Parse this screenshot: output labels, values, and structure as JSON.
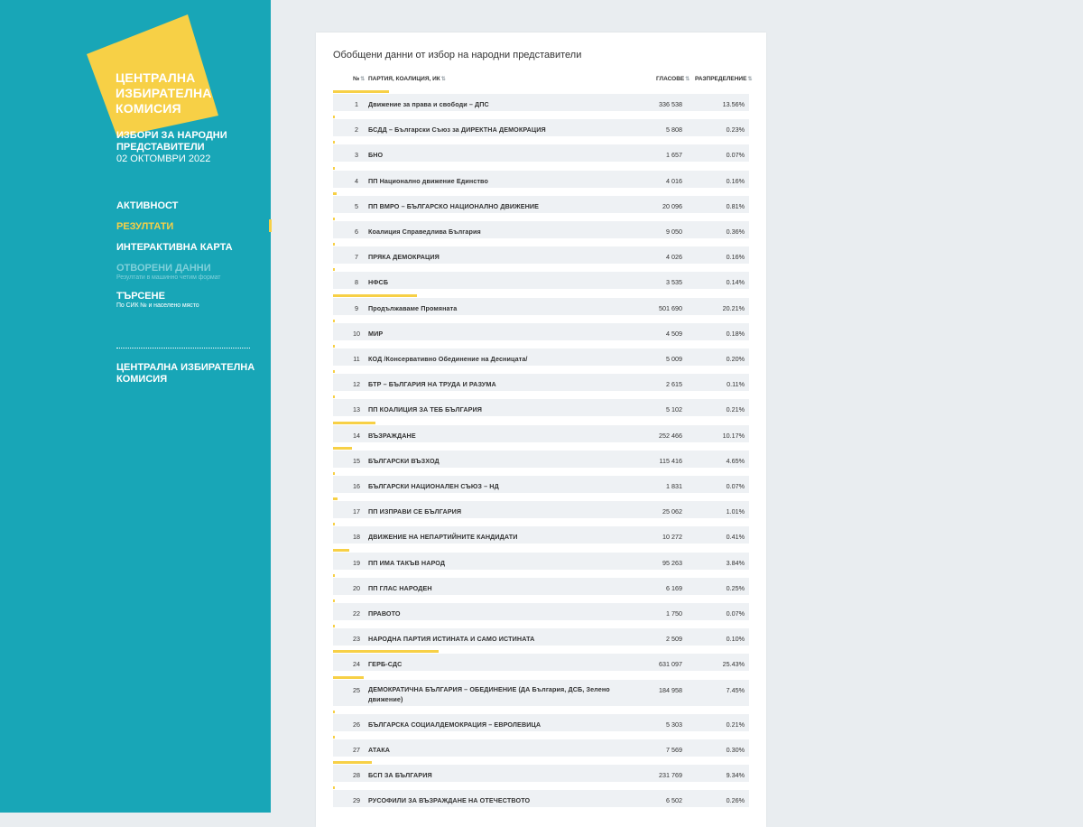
{
  "sidebar": {
    "logo_lines": [
      "ЦЕНТРАЛНА",
      "ИЗБИРАТЕЛНА",
      "КОМИСИЯ"
    ],
    "election_lines": [
      "ИЗБОРИ ЗА НАРОДНИ",
      "ПРЕДСТАВИТЕЛИ"
    ],
    "election_date": "02 ОКТОМВРИ 2022",
    "nav": [
      {
        "label": "АКТИВНОСТ",
        "sub": ""
      },
      {
        "label": "РЕЗУЛТАТИ",
        "sub": ""
      },
      {
        "label": "ИНТЕРАКТИВНА КАРТА",
        "sub": ""
      },
      {
        "label": "ОТВОРЕНИ ДАННИ",
        "sub": "Резултати в машинно четим формат"
      },
      {
        "label": "ТЪРСЕНЕ",
        "sub": "По СИК № и населено място"
      }
    ],
    "cik_lines": [
      "ЦЕНТРАЛНА ИЗБИРАТЕЛНА",
      "КОМИСИЯ"
    ]
  },
  "table": {
    "title": "Обобщени данни от избор на народни представители",
    "headers": {
      "num": "№",
      "party": "ПАРТИЯ, КОАЛИЦИЯ, ИК",
      "votes": "ГЛАСОВЕ",
      "share": "РАЗПРЕДЕЛЕНИЕ"
    },
    "sort_icon": "⇅",
    "rows": [
      {
        "num": "1",
        "name": "Движение за права и свободи – ДПС",
        "votes": "336 538",
        "share": "13.56%",
        "pct": 13.56
      },
      {
        "num": "2",
        "name": "БСДД – Български Съюз за ДИРЕКТНА ДЕМОКРАЦИЯ",
        "votes": "5 808",
        "share": "0.23%",
        "pct": 0.23
      },
      {
        "num": "3",
        "name": "БНО",
        "votes": "1 657",
        "share": "0.07%",
        "pct": 0.07
      },
      {
        "num": "4",
        "name": "ПП Национално движение Единство",
        "votes": "4 016",
        "share": "0.16%",
        "pct": 0.16
      },
      {
        "num": "5",
        "name": "ПП ВМРО – БЪЛГАРСКО НАЦИОНАЛНО ДВИЖЕНИЕ",
        "votes": "20 096",
        "share": "0.81%",
        "pct": 0.81
      },
      {
        "num": "6",
        "name": "Коалиция Справедлива България",
        "votes": "9 050",
        "share": "0.36%",
        "pct": 0.36
      },
      {
        "num": "7",
        "name": "ПРЯКА ДЕМОКРАЦИЯ",
        "votes": "4 026",
        "share": "0.16%",
        "pct": 0.16
      },
      {
        "num": "8",
        "name": "НФСБ",
        "votes": "3 535",
        "share": "0.14%",
        "pct": 0.14
      },
      {
        "num": "9",
        "name": "Продължаваме Промяната",
        "votes": "501 690",
        "share": "20.21%",
        "pct": 20.21
      },
      {
        "num": "10",
        "name": "МИР",
        "votes": "4 509",
        "share": "0.18%",
        "pct": 0.18
      },
      {
        "num": "11",
        "name": "КОД /Консервативно Обединение на Десницата/",
        "votes": "5 009",
        "share": "0.20%",
        "pct": 0.2
      },
      {
        "num": "12",
        "name": "БТР – БЪЛГАРИЯ НА ТРУДА И РАЗУМА",
        "votes": "2 615",
        "share": "0.11%",
        "pct": 0.11
      },
      {
        "num": "13",
        "name": "ПП КОАЛИЦИЯ ЗА ТЕБ БЪЛГАРИЯ",
        "votes": "5 102",
        "share": "0.21%",
        "pct": 0.21
      },
      {
        "num": "14",
        "name": "ВЪЗРАЖДАНЕ",
        "votes": "252 466",
        "share": "10.17%",
        "pct": 10.17
      },
      {
        "num": "15",
        "name": "БЪЛГАРСКИ ВЪЗХОД",
        "votes": "115 416",
        "share": "4.65%",
        "pct": 4.65
      },
      {
        "num": "16",
        "name": "БЪЛГАРСКИ НАЦИОНАЛЕН СЪЮЗ – НД",
        "votes": "1 831",
        "share": "0.07%",
        "pct": 0.07
      },
      {
        "num": "17",
        "name": "ПП ИЗПРАВИ СЕ БЪЛГАРИЯ",
        "votes": "25 062",
        "share": "1.01%",
        "pct": 1.01
      },
      {
        "num": "18",
        "name": "ДВИЖЕНИЕ НА НЕПАРТИЙНИТЕ КАНДИДАТИ",
        "votes": "10 272",
        "share": "0.41%",
        "pct": 0.41
      },
      {
        "num": "19",
        "name": "ПП ИМА ТАКЪВ НАРОД",
        "votes": "95 263",
        "share": "3.84%",
        "pct": 3.84
      },
      {
        "num": "20",
        "name": "ПП ГЛАС НАРОДЕН",
        "votes": "6 169",
        "share": "0.25%",
        "pct": 0.25
      },
      {
        "num": "22",
        "name": "ПРАВОТО",
        "votes": "1 750",
        "share": "0.07%",
        "pct": 0.07
      },
      {
        "num": "23",
        "name": "НАРОДНА ПАРТИЯ ИСТИНАТА И САМО ИСТИНАТА",
        "votes": "2 509",
        "share": "0.10%",
        "pct": 0.1
      },
      {
        "num": "24",
        "name": "ГЕРБ-СДС",
        "votes": "631 097",
        "share": "25.43%",
        "pct": 25.43
      },
      {
        "num": "25",
        "name": "ДЕМОКРАТИЧНА БЪЛГАРИЯ – ОБЕДИНЕНИЕ (ДА България, ДСБ, Зелено движение)",
        "votes": "184 958",
        "share": "7.45%",
        "pct": 7.45,
        "tall": true
      },
      {
        "num": "26",
        "name": "БЪЛГАРСКА СОЦИАЛДЕМОКРАЦИЯ – ЕВРОЛЕВИЦА",
        "votes": "5 303",
        "share": "0.21%",
        "pct": 0.21
      },
      {
        "num": "27",
        "name": "АТАКА",
        "votes": "7 569",
        "share": "0.30%",
        "pct": 0.3
      },
      {
        "num": "28",
        "name": "БСП ЗА БЪЛГАРИЯ",
        "votes": "231 769",
        "share": "9.34%",
        "pct": 9.34
      },
      {
        "num": "29",
        "name": "РУСОФИЛИ ЗА ВЪЗРАЖДАНЕ НА ОТЕЧЕСТВОТО",
        "votes": "6 502",
        "share": "0.26%",
        "pct": 0.26
      }
    ]
  },
  "colors": {
    "sidebar": "#18a6b7",
    "accent": "#f7d046",
    "row": "#eef1f4"
  }
}
